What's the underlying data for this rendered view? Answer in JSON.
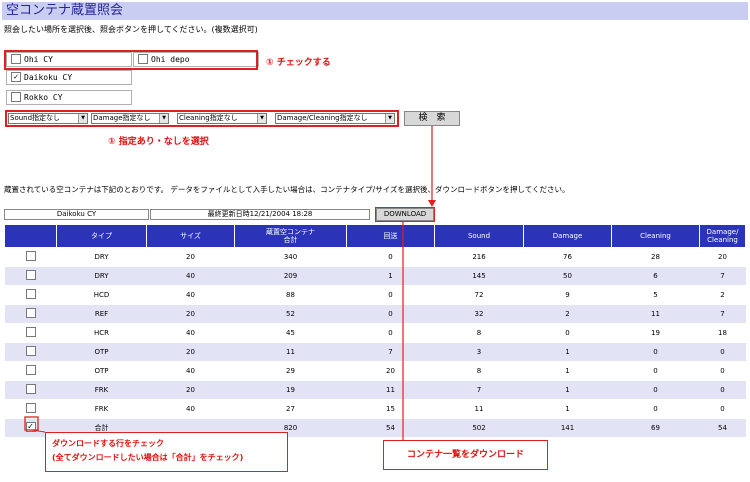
{
  "page": {
    "title": "空コンテナ蔵置照会",
    "instruction": "照会したい場所を選択後、照会ボタンを押してください。(複数選択可)"
  },
  "locations": [
    {
      "label": "Ohi CY",
      "checked": false
    },
    {
      "label": "Ohi depo",
      "checked": false
    },
    {
      "label": "Daikoku CY",
      "checked": true
    },
    {
      "label": "Rokko CY",
      "checked": false
    }
  ],
  "annotations": {
    "check": "① チェックする",
    "select": "① 指定あり・なしを選択",
    "row_check_line1": "ダウンロードする行をチェック",
    "row_check_line2": "(全てダウンロードしたい場合は「合計」をチェック)",
    "download": "コンテナ一覧をダウンロード"
  },
  "filters": [
    {
      "value": "Sound指定なし"
    },
    {
      "value": "Damage指定なし"
    },
    {
      "value": "Cleaning指定なし"
    },
    {
      "value": "Damage/Cleaning指定なし"
    }
  ],
  "search_button": "検　索",
  "result_text": "蔵置されている空コンテナは下記のとおりです。 データをファイルとして入手したい場合は、コンテナタイプ/サイズを選択後、ダウンロードボタンを押してください。",
  "result_location": "Daikoku CY",
  "last_update": "最終更新日時12/21/2004 18:28",
  "download_button": "DOWNLOAD",
  "table": {
    "headers": [
      "",
      "タイプ",
      "サイズ",
      "蔵置空コンテナ\n合計",
      "回送",
      "Sound",
      "Damage",
      "Cleaning",
      "Damage/\nCleaning"
    ],
    "rows": [
      {
        "checked": false,
        "cells": [
          "DRY",
          "20",
          "340",
          "0",
          "216",
          "76",
          "28",
          "20"
        ]
      },
      {
        "checked": false,
        "cells": [
          "DRY",
          "40",
          "209",
          "1",
          "145",
          "50",
          "6",
          "7"
        ]
      },
      {
        "checked": false,
        "cells": [
          "HCD",
          "40",
          "88",
          "0",
          "72",
          "9",
          "5",
          "2"
        ]
      },
      {
        "checked": false,
        "cells": [
          "REF",
          "20",
          "52",
          "0",
          "32",
          "2",
          "11",
          "7"
        ]
      },
      {
        "checked": false,
        "cells": [
          "HCR",
          "40",
          "45",
          "0",
          "8",
          "0",
          "19",
          "18"
        ]
      },
      {
        "checked": false,
        "cells": [
          "OTP",
          "20",
          "11",
          "7",
          "3",
          "1",
          "0",
          "0"
        ]
      },
      {
        "checked": false,
        "cells": [
          "OTP",
          "40",
          "29",
          "20",
          "8",
          "1",
          "0",
          "0"
        ]
      },
      {
        "checked": false,
        "cells": [
          "FRK",
          "20",
          "19",
          "11",
          "7",
          "1",
          "0",
          "0"
        ]
      },
      {
        "checked": false,
        "cells": [
          "FRK",
          "40",
          "27",
          "15",
          "11",
          "1",
          "0",
          "0"
        ]
      },
      {
        "checked": true,
        "cells": [
          "合計",
          "",
          "820",
          "54",
          "502",
          "141",
          "69",
          "54"
        ]
      }
    ]
  },
  "colors": {
    "header": "#2b34b8",
    "alt_row": "#e3e3f6",
    "annotation": "#e02020",
    "title_bg": "#c9cdf2"
  }
}
